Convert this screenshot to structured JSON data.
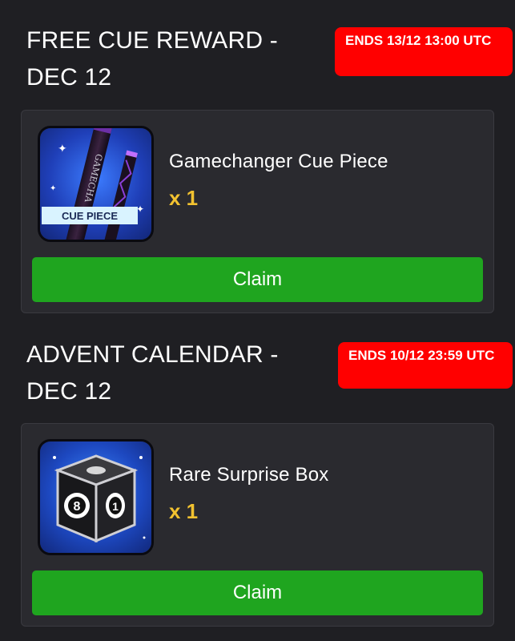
{
  "offers": [
    {
      "title": "FREE CUE REWARD - DEC 12",
      "badge": "ENDS 13/12 13:00 UTC",
      "item": {
        "name": "Gamechanger Cue Piece",
        "quantity": "x 1",
        "image_label": "CUE PIECE",
        "image_icon": "cue-piece-icon"
      },
      "claim_label": "Claim"
    },
    {
      "title": "ADVENT CALENDAR - DEC 12",
      "badge": "ENDS 10/12 23:59 UTC",
      "item": {
        "name": "Rare Surprise Box",
        "quantity": "x 1",
        "image_icon": "surprise-box-icon"
      },
      "claim_label": "Claim"
    }
  ],
  "colors": {
    "background": "#1f1f23",
    "card": "#2a2a2f",
    "badge": "#ff0000",
    "claim_button": "#1fa51f",
    "quantity": "#f2c230"
  }
}
